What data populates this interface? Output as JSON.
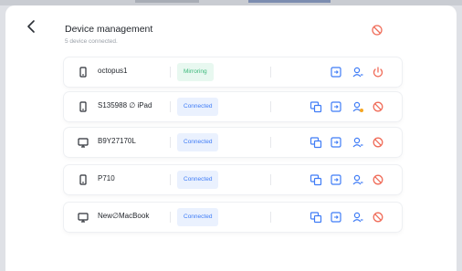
{
  "header": {
    "title": "Device management",
    "subtitle": "5 device connected."
  },
  "colors": {
    "accent": "#3f7cf6",
    "danger": "#f06d5a",
    "mirroring": "#3bb87a"
  },
  "devices": [
    {
      "name": "octopus1",
      "icon": "phone-icon",
      "status": "Mirroring",
      "actions": [
        "file-transfer",
        "user-permission",
        "power-off"
      ]
    },
    {
      "name": "S135988 ∅ iPad",
      "icon": "phone-icon",
      "status": "Connected",
      "actions": [
        "screen-mirror",
        "file-transfer",
        "user-permission-pending",
        "disconnect"
      ]
    },
    {
      "name": "B9Y27170L",
      "icon": "monitor-icon",
      "status": "Connected",
      "actions": [
        "screen-mirror",
        "file-transfer",
        "user-permission",
        "disconnect"
      ]
    },
    {
      "name": "P710",
      "icon": "phone-icon",
      "status": "Connected",
      "actions": [
        "screen-mirror",
        "file-transfer",
        "user-permission",
        "disconnect"
      ]
    },
    {
      "name": "New∅MacBook",
      "icon": "monitor-icon",
      "status": "Connected",
      "actions": [
        "screen-mirror",
        "file-transfer",
        "user-permission",
        "disconnect"
      ]
    }
  ]
}
